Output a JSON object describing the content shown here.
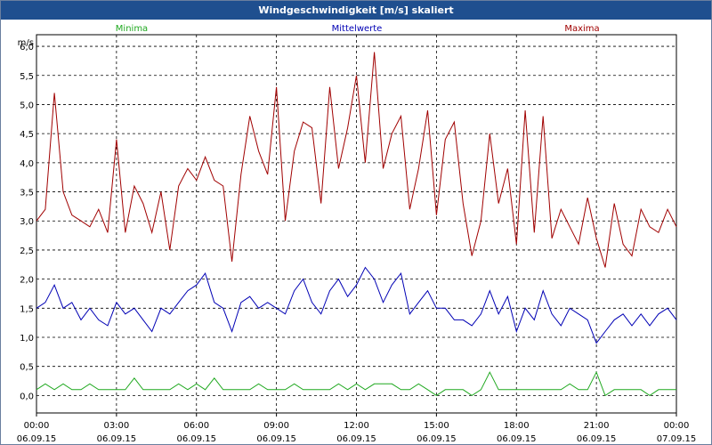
{
  "title": "Windgeschwindigkeit [m/s] skaliert",
  "colors": {
    "minima": "#1fa81f",
    "mittel": "#0000b4",
    "maxima": "#a00000",
    "title_bg": "#1f4f8f"
  },
  "chart_data": {
    "type": "line",
    "title": "Windgeschwindigkeit [m/s] skaliert",
    "ylabel": "m/s",
    "ylim": [
      -0.3,
      6.2
    ],
    "y_ticks": [
      "6,0",
      "5,5",
      "5,0",
      "4,5",
      "4,0",
      "3,5",
      "3,0",
      "2,5",
      "2,0",
      "1,5",
      "1,0",
      "0,5",
      "0,0"
    ],
    "x_ticks": [
      {
        "time": "00:00",
        "date": "06.09.15"
      },
      {
        "time": "03:00",
        "date": "06.09.15"
      },
      {
        "time": "06:00",
        "date": "06.09.15"
      },
      {
        "time": "09:00",
        "date": "06.09.15"
      },
      {
        "time": "12:00",
        "date": "06.09.15"
      },
      {
        "time": "15:00",
        "date": "06.09.15"
      },
      {
        "time": "18:00",
        "date": "06.09.15"
      },
      {
        "time": "21:00",
        "date": "06.09.15"
      },
      {
        "time": "00:00",
        "date": "07.09.15"
      }
    ],
    "grid": true,
    "x_hours": [
      0,
      0.33,
      0.67,
      1,
      1.33,
      1.67,
      2,
      2.33,
      2.67,
      3,
      3.33,
      3.67,
      4,
      4.33,
      4.67,
      5,
      5.33,
      5.67,
      6,
      6.33,
      6.67,
      7,
      7.33,
      7.67,
      8,
      8.33,
      8.67,
      9,
      9.33,
      9.67,
      10,
      10.33,
      10.67,
      11,
      11.33,
      11.67,
      12,
      12.33,
      12.67,
      13,
      13.33,
      13.67,
      14,
      14.33,
      14.67,
      15,
      15.33,
      15.67,
      16,
      16.33,
      16.67,
      17,
      17.33,
      17.67,
      18,
      18.33,
      18.67,
      19,
      19.33,
      19.67,
      20,
      20.33,
      20.67,
      21,
      21.33,
      21.67,
      22,
      22.33,
      22.67,
      23,
      23.33,
      23.67,
      24
    ],
    "series": [
      {
        "name": "Maxima",
        "values": [
          3.0,
          3.2,
          5.2,
          3.5,
          3.1,
          3.0,
          2.9,
          3.2,
          2.8,
          4.4,
          2.8,
          3.6,
          3.3,
          2.8,
          3.5,
          2.5,
          3.6,
          3.9,
          3.7,
          4.1,
          3.7,
          3.6,
          2.3,
          3.8,
          4.8,
          4.2,
          3.8,
          5.3,
          3.0,
          4.2,
          4.7,
          4.6,
          3.3,
          5.3,
          3.9,
          4.6,
          5.5,
          4.0,
          5.9,
          3.9,
          4.5,
          4.8,
          3.2,
          3.9,
          4.9,
          3.1,
          4.4,
          4.7,
          3.3,
          2.4,
          3.0,
          4.5,
          3.3,
          3.9,
          2.6,
          4.9,
          2.8,
          4.8,
          2.7,
          3.2,
          2.9,
          2.6,
          3.4,
          2.7,
          2.2,
          3.3,
          2.6,
          2.4,
          3.2,
          2.9,
          2.8,
          3.2,
          2.9
        ],
        "color": "#a00000"
      },
      {
        "name": "Mittelwerte",
        "values": [
          1.5,
          1.6,
          1.9,
          1.5,
          1.6,
          1.3,
          1.5,
          1.3,
          1.2,
          1.6,
          1.4,
          1.5,
          1.3,
          1.1,
          1.5,
          1.4,
          1.6,
          1.8,
          1.9,
          2.1,
          1.6,
          1.5,
          1.1,
          1.6,
          1.7,
          1.5,
          1.6,
          1.5,
          1.4,
          1.8,
          2.0,
          1.6,
          1.4,
          1.8,
          2.0,
          1.7,
          1.9,
          2.2,
          2.0,
          1.6,
          1.9,
          2.1,
          1.4,
          1.6,
          1.8,
          1.5,
          1.5,
          1.3,
          1.3,
          1.2,
          1.4,
          1.8,
          1.4,
          1.7,
          1.1,
          1.5,
          1.3,
          1.8,
          1.4,
          1.2,
          1.5,
          1.4,
          1.3,
          0.9,
          1.1,
          1.3,
          1.4,
          1.2,
          1.4,
          1.2,
          1.4,
          1.5,
          1.3
        ],
        "color": "#0000b4"
      },
      {
        "name": "Minima",
        "values": [
          0.1,
          0.2,
          0.1,
          0.2,
          0.1,
          0.1,
          0.2,
          0.1,
          0.1,
          0.1,
          0.1,
          0.3,
          0.1,
          0.1,
          0.1,
          0.1,
          0.2,
          0.1,
          0.2,
          0.1,
          0.3,
          0.1,
          0.1,
          0.1,
          0.1,
          0.2,
          0.1,
          0.1,
          0.1,
          0.2,
          0.1,
          0.1,
          0.1,
          0.1,
          0.2,
          0.1,
          0.2,
          0.1,
          0.2,
          0.2,
          0.2,
          0.1,
          0.1,
          0.2,
          0.1,
          0.0,
          0.1,
          0.1,
          0.1,
          0.0,
          0.1,
          0.4,
          0.1,
          0.1,
          0.1,
          0.1,
          0.1,
          0.1,
          0.1,
          0.1,
          0.2,
          0.1,
          0.1,
          0.4,
          0.0,
          0.1,
          0.1,
          0.1,
          0.1,
          0.0,
          0.1,
          0.1,
          0.1
        ],
        "color": "#1fa81f"
      }
    ]
  }
}
